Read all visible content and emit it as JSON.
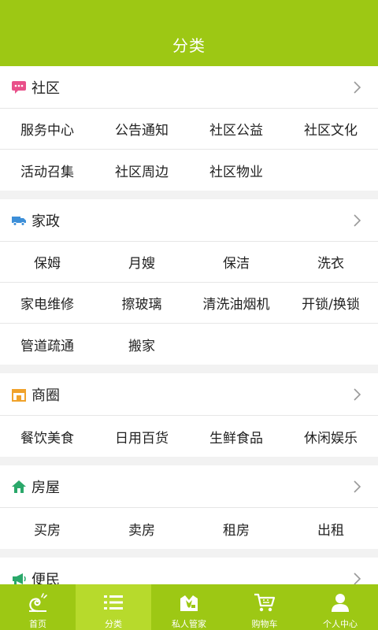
{
  "header": {
    "title": "分类"
  },
  "sections": [
    {
      "title": "社区",
      "icon": "chat-bubble-icon",
      "icon_color": "#e9508a",
      "rows": [
        [
          "服务中心",
          "公告通知",
          "社区公益",
          "社区文化"
        ],
        [
          "活动召集",
          "社区周边",
          "社区物业",
          ""
        ]
      ]
    },
    {
      "title": "家政",
      "icon": "truck-icon",
      "icon_color": "#3d8fd8",
      "rows": [
        [
          "保姆",
          "月嫂",
          "保洁",
          "洗衣"
        ],
        [
          "家电维修",
          "擦玻璃",
          "清洗油烟机",
          "开锁/换锁"
        ],
        [
          "管道疏通",
          "搬家",
          "",
          ""
        ]
      ]
    },
    {
      "title": "商圈",
      "icon": "storefront-icon",
      "icon_color": "#f0a22a",
      "rows": [
        [
          "餐饮美食",
          "日用百货",
          "生鲜食品",
          "休闲娱乐"
        ]
      ]
    },
    {
      "title": "房屋",
      "icon": "house-icon",
      "icon_color": "#2aa86a",
      "rows": [
        [
          "买房",
          "卖房",
          "租房",
          "出租"
        ]
      ]
    },
    {
      "title": "便民",
      "icon": "megaphone-icon",
      "icon_color": "#2aa86a",
      "rows": []
    }
  ],
  "tabbar": {
    "items": [
      {
        "label": "首页",
        "icon": "snail-home-icon",
        "active": false
      },
      {
        "label": "分类",
        "icon": "list-icon",
        "active": true
      },
      {
        "label": "私人管家",
        "icon": "butler-icon",
        "active": false
      },
      {
        "label": "购物车",
        "icon": "cart-icon",
        "active": false
      },
      {
        "label": "个人中心",
        "icon": "person-icon",
        "active": false
      }
    ]
  },
  "colors": {
    "brand": "#9dc814",
    "active_tab": "#b7da2c"
  }
}
